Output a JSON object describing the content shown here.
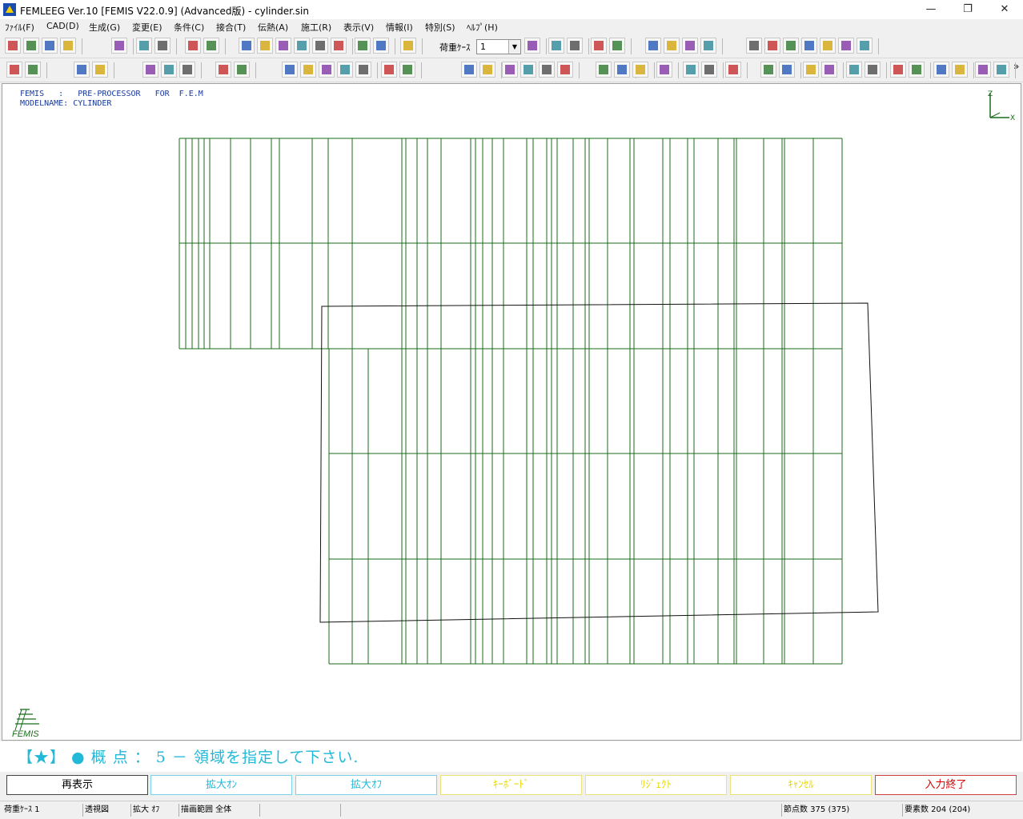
{
  "window": {
    "title": "FEMLEEG Ver.10 [FEMIS V22.0.9] (Advanced版) - cylinder.sin",
    "minimize": "—",
    "restore": "❐",
    "close": "✕"
  },
  "menu": [
    "ﾌｧｲﾙ(F)",
    "CAD(D)",
    "生成(G)",
    "変更(E)",
    "条件(C)",
    "接合(T)",
    "伝熱(A)",
    "施工(R)",
    "表示(V)",
    "情報(I)",
    "特別(S)",
    "ﾍﾙﾌﾟ(H)"
  ],
  "toolbar": {
    "load_case_label": "荷重ｹｰｽ",
    "load_case_value": "1",
    "load_case_arrow": "▼",
    "more": "»"
  },
  "canvas": {
    "header_line1": "FEMIS   :   PRE-PROCESSOR   FOR  F.E.M",
    "header_line2": "MODELNAME: CYLINDER",
    "axis_z": "Z",
    "axis_x": "X",
    "logo_text": "FEMIS",
    "mesh_color": "#1a6b1a"
  },
  "prompt": {
    "text": "【★】 ● 概 点 ： 5 － 領域を指定して下さい."
  },
  "function_buttons": [
    {
      "label": "再表示",
      "color": "#000000"
    },
    {
      "label": "拡大ｵﾝ",
      "color": "#22b8d8"
    },
    {
      "label": "拡大ｵﾌ",
      "color": "#22b8d8"
    },
    {
      "label": "ｷｰﾎﾞｰﾄﾞ",
      "color": "#e8d800"
    },
    {
      "label": "ﾘｼﾞｪｸﾄ",
      "color": "#e8d800"
    },
    {
      "label": "ｷｬﾝｾﾙ",
      "color": "#e8d800"
    },
    {
      "label": "入力終了",
      "color": "#d80000"
    }
  ],
  "status": {
    "load_case": "荷重ｹｰｽ 1",
    "view": "透視図",
    "zoom": "拡大 ｵﾌ",
    "range": "描画範囲 全体",
    "nodes": "節点数 375 (375)",
    "elements": "要素数 204 (204)"
  }
}
